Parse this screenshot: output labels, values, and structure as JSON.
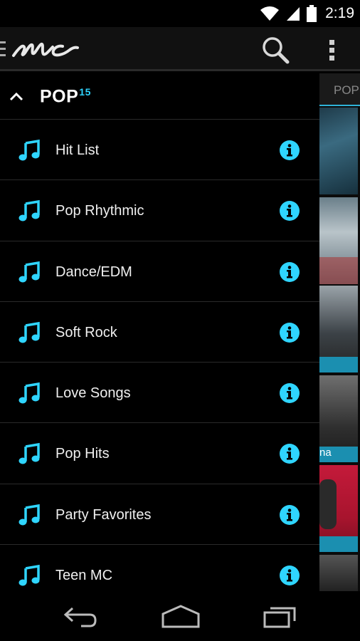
{
  "status_bar": {
    "time": "2:19",
    "icons": [
      "wifi-icon",
      "cell-signal-icon",
      "battery-icon"
    ]
  },
  "action_bar": {
    "logo": "mc",
    "icons": [
      "drawer-indicator-icon",
      "search-icon",
      "overflow-menu-icon"
    ]
  },
  "drawer": {
    "genre": "POP",
    "count": "15",
    "items": [
      {
        "label": "Hit List"
      },
      {
        "label": "Pop Rhythmic"
      },
      {
        "label": "Dance/EDM"
      },
      {
        "label": "Soft Rock"
      },
      {
        "label": "Love Songs"
      },
      {
        "label": "Pop Hits"
      },
      {
        "label": "Party Favorites"
      },
      {
        "label": "Teen MC"
      }
    ]
  },
  "peek": {
    "tab_label": "POP",
    "caption": "na"
  },
  "nav_bar": {
    "icons": [
      "back-icon",
      "home-icon",
      "recent-apps-icon"
    ]
  },
  "colors": {
    "accent": "#2fd5ff",
    "tab_indicator": "#2fb3d8"
  }
}
